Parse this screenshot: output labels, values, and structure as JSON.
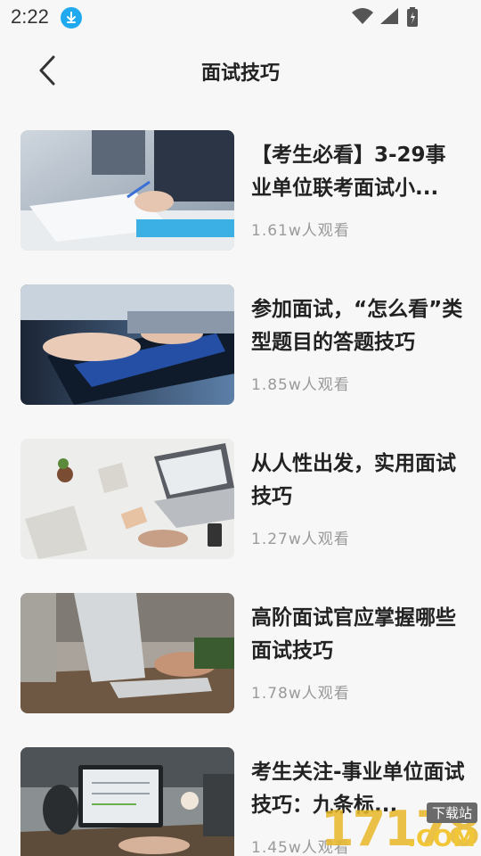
{
  "status_bar": {
    "time": "2:22",
    "icons": [
      "download-icon",
      "wifi-icon",
      "signal-icon",
      "battery-icon"
    ]
  },
  "header": {
    "title": "面试技巧",
    "back_icon": "back-arrow-icon"
  },
  "articles": [
    {
      "title": "【考生必看】3-29事业单位联考面试小...",
      "views": "1.61w人观看"
    },
    {
      "title": "参加面试，“怎么看”类型题目的答题技巧",
      "views": "1.85w人观看"
    },
    {
      "title": "从人性出发，实用面试技巧",
      "views": "1.27w人观看"
    },
    {
      "title": "高阶面试官应掌握哪些面试技巧",
      "views": "1.78w人观看"
    },
    {
      "title": "考生关注-事业单位面试技巧：九条标...",
      "views": "1.45w人观看"
    }
  ],
  "watermark": {
    "tag": "下载站",
    "digits": "17178",
    "suffix": ".COM"
  },
  "colors": {
    "accent": "#21a9f0",
    "muted_text": "#9a9a9a",
    "background": "#f7f7f7"
  }
}
